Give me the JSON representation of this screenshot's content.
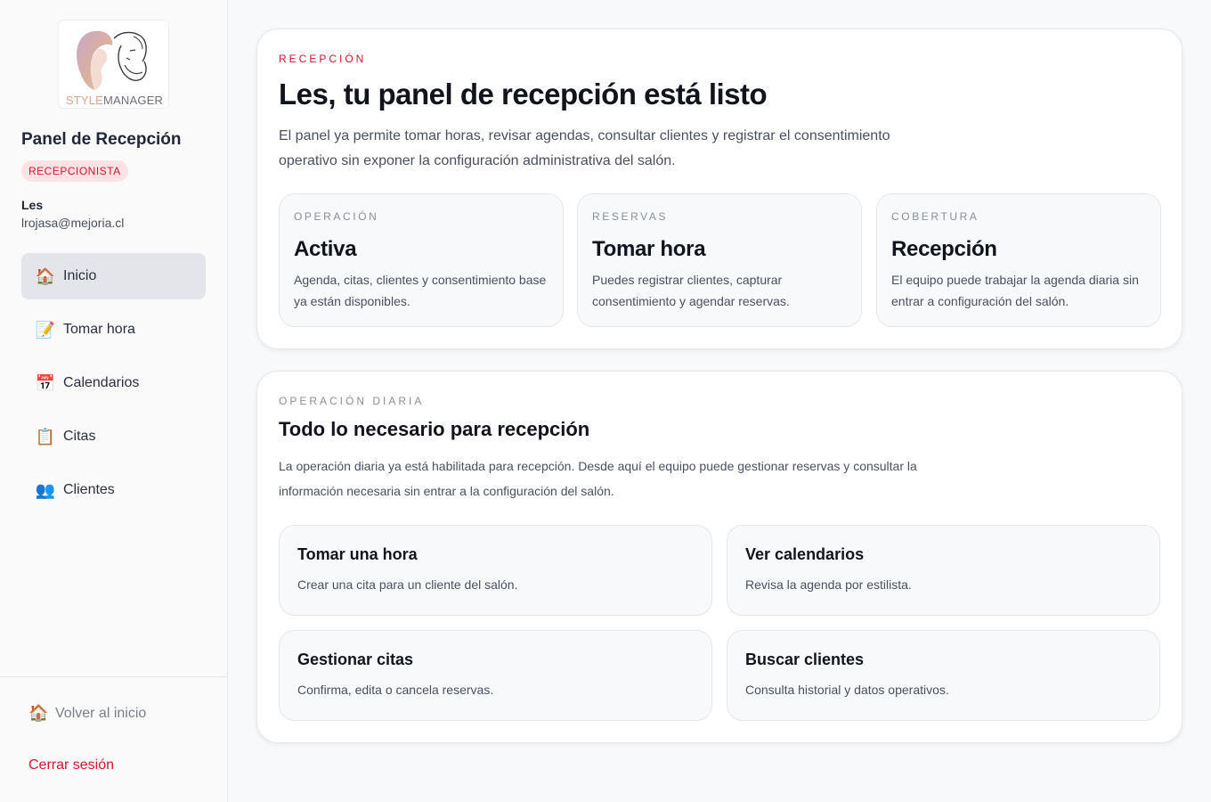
{
  "sidebar": {
    "logo": {
      "word_a": "STYLE",
      "word_b": "MANAGER"
    },
    "title": "Panel de Recepción",
    "role": "RECEPCIONISTA",
    "user": {
      "name": "Les",
      "email": "lrojasa@mejoria.cl"
    },
    "nav": [
      {
        "label": "Inicio",
        "icon": "house-icon",
        "glyph": "🏠",
        "active": true
      },
      {
        "label": "Tomar hora",
        "icon": "memo-icon",
        "glyph": "📝",
        "active": false
      },
      {
        "label": "Calendarios",
        "icon": "calendar-icon",
        "glyph": "📅",
        "active": false
      },
      {
        "label": "Citas",
        "icon": "clipboard-icon",
        "glyph": "📋",
        "active": false
      },
      {
        "label": "Clientes",
        "icon": "people-icon",
        "glyph": "👥",
        "active": false
      }
    ],
    "back_home": {
      "label": "Volver al inicio",
      "icon": "house-icon",
      "glyph": "🏠"
    },
    "logout": "Cerrar sesión"
  },
  "hero": {
    "eyebrow": "RECEPCIÓN",
    "title": "Les, tu panel de recepción está listo",
    "description": "El panel ya permite tomar horas, revisar agendas, consultar clientes y registrar el consentimiento operativo sin exponer la configuración administrativa del salón.",
    "stats": [
      {
        "label": "OPERACIÓN",
        "value": "Activa",
        "description": "Agenda, citas, clientes y consentimiento base ya están disponibles."
      },
      {
        "label": "RESERVAS",
        "value": "Tomar hora",
        "description": "Puedes registrar clientes, capturar consentimiento y agendar reservas."
      },
      {
        "label": "COBERTURA",
        "value": "Recepción",
        "description": "El equipo puede trabajar la agenda diaria sin entrar a configuración del salón."
      }
    ]
  },
  "daily": {
    "eyebrow": "OPERACIÓN DIARIA",
    "title": "Todo lo necesario para recepción",
    "description": "La operación diaria ya está habilitada para recepción. Desde aquí el equipo puede gestionar reservas y consultar la información necesaria sin entrar a la configuración del salón.",
    "actions": [
      {
        "title": "Tomar una hora",
        "description": "Crear una cita para un cliente del salón."
      },
      {
        "title": "Ver calendarios",
        "description": "Revisa la agenda por estilista."
      },
      {
        "title": "Gestionar citas",
        "description": "Confirma, edita o cancela reservas."
      },
      {
        "title": "Buscar clientes",
        "description": "Consulta historial y datos operativos."
      }
    ]
  },
  "colors": {
    "accent": "#d8122f",
    "active_bg": "#e4e5ea",
    "badge_bg": "#fde2e5"
  }
}
